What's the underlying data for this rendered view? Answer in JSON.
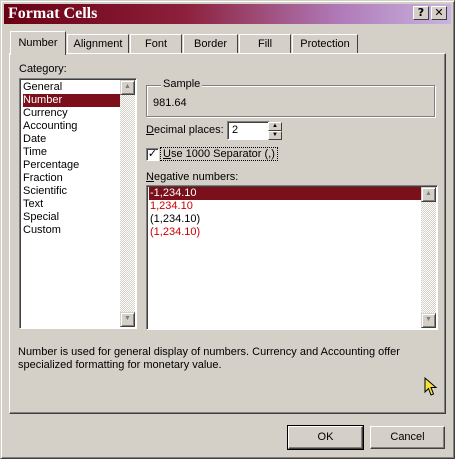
{
  "window": {
    "title": "Format Cells",
    "help_glyph": "?",
    "close_glyph": "✕"
  },
  "tabs": [
    {
      "label": "Number",
      "active": true
    },
    {
      "label": "Alignment",
      "active": false
    },
    {
      "label": "Font",
      "active": false
    },
    {
      "label": "Border",
      "active": false
    },
    {
      "label": "Fill",
      "active": false
    },
    {
      "label": "Protection",
      "active": false
    }
  ],
  "category": {
    "label": "Category:",
    "items": [
      "General",
      "Number",
      "Currency",
      "Accounting",
      "Date",
      "Time",
      "Percentage",
      "Fraction",
      "Scientific",
      "Text",
      "Special",
      "Custom"
    ],
    "selected": "Number"
  },
  "sample": {
    "label": "Sample",
    "value": "981.64"
  },
  "decimal_places": {
    "label": "Decimal places:",
    "value": "2"
  },
  "separator": {
    "label": "Use 1000 Separator (,)",
    "checked": true
  },
  "negative_numbers": {
    "label": "Negative numbers:",
    "items": [
      {
        "text": "-1,234.10",
        "color": "#000000",
        "selected": true
      },
      {
        "text": "1,234.10",
        "color": "#cc0000",
        "selected": false
      },
      {
        "text": "(1,234.10)",
        "color": "#000000",
        "selected": false
      },
      {
        "text": "(1,234.10)",
        "color": "#cc0000",
        "selected": false
      }
    ]
  },
  "description": "Number is used for general display of numbers.  Currency and Accounting offer specialized formatting for monetary value.",
  "buttons": {
    "ok": "OK",
    "cancel": "Cancel"
  }
}
